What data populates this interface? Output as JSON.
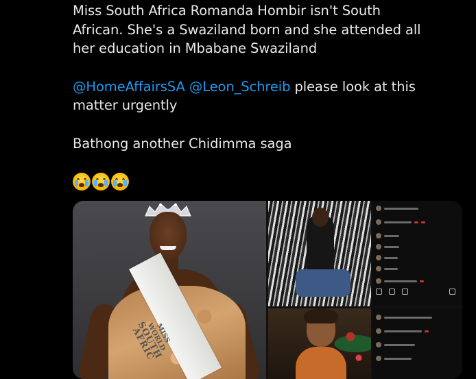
{
  "tweet": {
    "line1": "Miss South Africa Romanda Hombir isn't South",
    "line2": "African. She's a Swaziland born and she attended all",
    "line3": "her education in Mbabane Swaziland",
    "mention1": "@HomeAffairsSA",
    "mention2": "@Leon_Schreib",
    "line4_rest": " please look at this",
    "line5": "matter urgently",
    "line6": "Bathong another Chidimma saga",
    "emoji_names": [
      "loudly-crying-face-icon",
      "loudly-crying-face-icon",
      "loudly-crying-face-icon"
    ]
  },
  "media": {
    "sash_line1": "MISS WORLD",
    "sash_line2": "SOUTH AFRIC"
  },
  "colors": {
    "background": "#000000",
    "text": "#e7e9ea",
    "mention": "#1d9bf0"
  }
}
